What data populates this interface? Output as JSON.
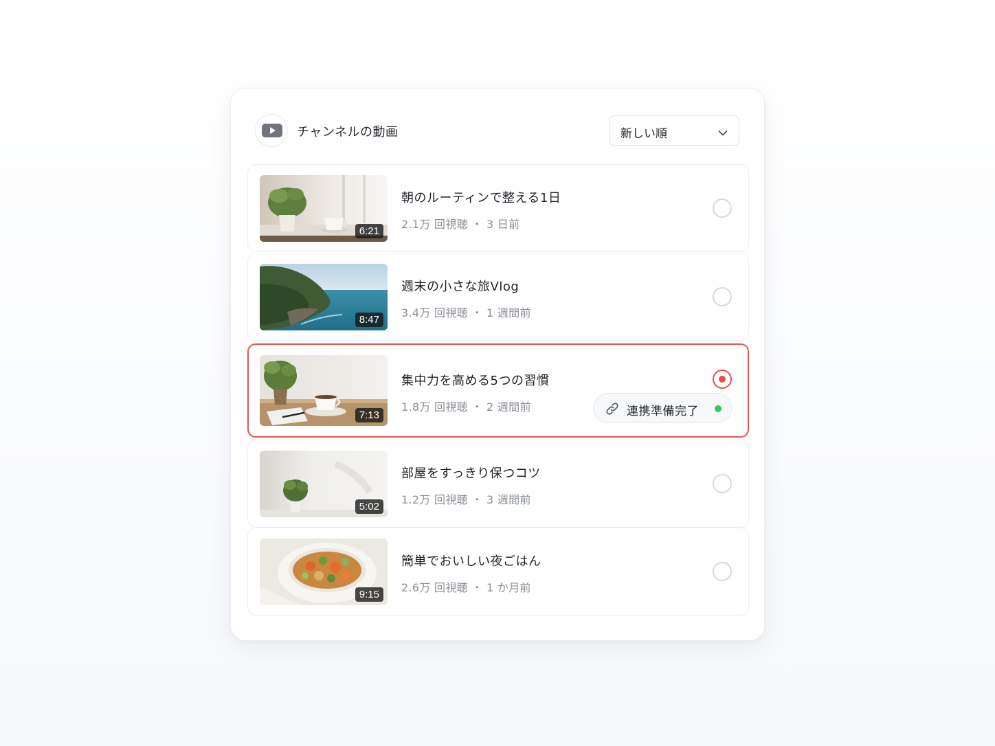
{
  "header": {
    "channel_icon": "video-play-icon",
    "title": "チャンネルの動画",
    "sort": {
      "selected": "新しい順",
      "icon": "chevron-down-icon"
    }
  },
  "videos": [
    {
      "title": "朝のルーティンで整える1日",
      "meta": "2.1万 回視聴 ・ 3 日前",
      "duration": "6:21",
      "thumbnail": "plant-and-cup-window",
      "selected": false
    },
    {
      "title": "週末の小さな旅Vlog",
      "meta": "3.4万 回視聴 ・ 1 週間前",
      "duration": "8:47",
      "thumbnail": "coastal-cliff-sea",
      "selected": false
    },
    {
      "title": "集中力を高める5つの習慣",
      "meta": "1.8万 回視聴 ・ 2 週間前",
      "duration": "7:13",
      "thumbnail": "plant-coffee-notebook",
      "selected": true
    },
    {
      "title": "部屋をすっきり保つコツ",
      "meta": "1.2万 回視聴 ・ 3 週間前",
      "duration": "5:02",
      "thumbnail": "plant-white-wall",
      "selected": false
    },
    {
      "title": "簡単でおいしい夜ごはん",
      "meta": "2.6万 回視聴 ・ 1 か月前",
      "duration": "9:15",
      "thumbnail": "vegetable-stew-bowl",
      "selected": false
    }
  ],
  "status": {
    "icon": "link-icon",
    "label": "連携準備完了",
    "indicator_color": "#34c759"
  },
  "colors": {
    "accent": "#e0514a",
    "border": "#eceef1",
    "muted_text": "#8a8f96"
  }
}
